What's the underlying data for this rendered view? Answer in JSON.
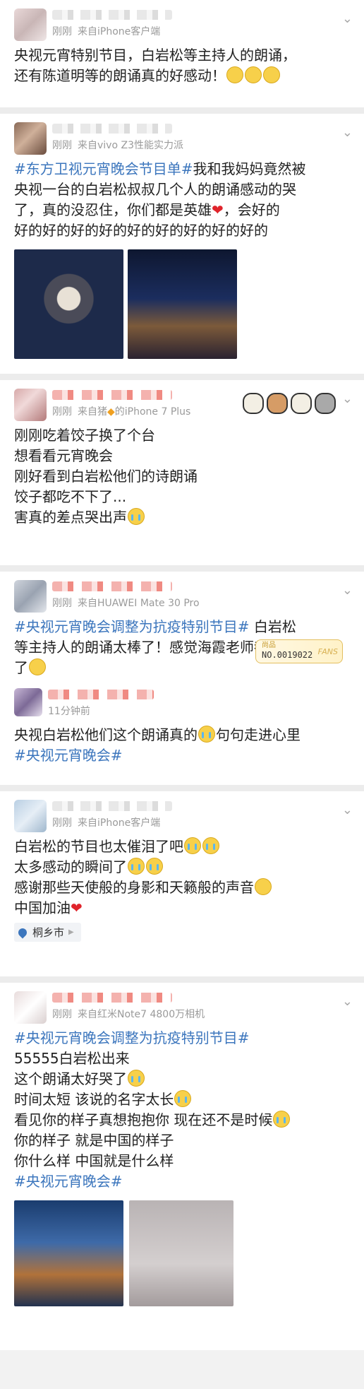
{
  "posts": [
    {
      "time": "刚刚",
      "source": "来自iPhone客户端",
      "lines": [
        "央视元宵特别节目，白岩松等主持人的朗诵，",
        "还有陈道明等的朗诵真的好感动！"
      ]
    },
    {
      "time": "刚刚",
      "source": "来自vivo Z3性能实力派",
      "hashtag": "#东方卫视元宵晚会节目单#",
      "text1": "我和我妈妈竟然被",
      "line2": "央视一台的白岩松叔叔几个人的朗诵感动的哭",
      "line3": "了，真的没忍住，你们都是英雄",
      "line3b": "，会好的",
      "line4": "好的好的好的好的好的好的好的好的好的"
    },
    {
      "time": "刚刚",
      "source": "来自猪",
      "source2": "的iPhone 7 Plus",
      "lines": [
        "刚刚吃着饺子换了个台",
        "想看看元宵晚会",
        "刚好看到白岩松他们的诗朗诵",
        "饺子都吃不下了...",
        "害真的差点哭出声"
      ]
    },
    {
      "time": "刚刚",
      "source": "来自HUAWEI Mate 30 Pro",
      "hashtag": "#央视元宵晚会调整为抗疫特别节目#",
      "text1": " 白岩松",
      "line2": "等主持人的朗诵太棒了！感觉海霞老师都要哭",
      "line3": "了"
    },
    {
      "time": "11分钟前",
      "badge_title": "尚品",
      "badge_no": "NO.0019022",
      "badge_fans": "FANS",
      "line1a": "央视白岩松他们这个朗诵真的",
      "line1b": "句句走进心里",
      "hashtag": "#央视元宵晚会#"
    },
    {
      "time": "刚刚",
      "source": "来自iPhone客户端",
      "lines": [
        "白岩松的节目也太催泪了吧",
        "太多感动的瞬间了",
        "感谢那些天使般的身影和天籁般的声音",
        "中国加油"
      ],
      "location": "桐乡市"
    },
    {
      "time": "刚刚",
      "source": "来自红米Note7 4800万相机",
      "hashtag": "#央视元宵晚会调整为抗疫特别节目#",
      "lines": [
        "55555白岩松出来",
        "这个朗诵太好哭了",
        "时间太短 该说的名字太长",
        "看见你的样子真想抱抱你 现在还不是时候",
        "你的样子 就是中国的样子",
        "你什么样 中国就是什么样"
      ],
      "hashtag2": "#央视元宵晚会#"
    }
  ]
}
